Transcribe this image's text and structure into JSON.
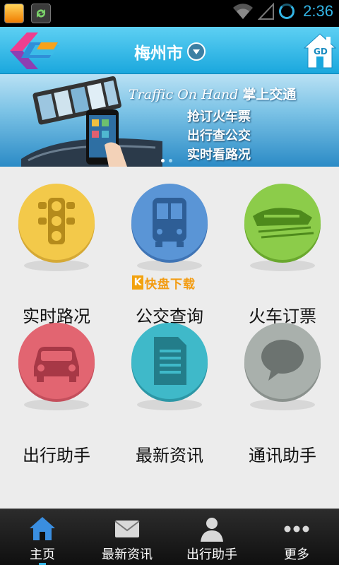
{
  "status_bar": {
    "time": "2:36"
  },
  "header": {
    "city": "梅州市",
    "home_badge": "GD"
  },
  "banner": {
    "tagline_en": "Traffic On Hand",
    "tagline_cn": "掌上交通",
    "lines": [
      "抢订火车票",
      "出行查公交",
      "实时看路况"
    ]
  },
  "grid": [
    {
      "label": "实时路况",
      "icon": "traffic-light-icon",
      "color": "#f3c94a"
    },
    {
      "label": "公交查询",
      "icon": "bus-icon",
      "color": "#5a95d6"
    },
    {
      "label": "火车订票",
      "icon": "train-icon",
      "color": "#8ccc4a"
    },
    {
      "label": "出行助手",
      "icon": "car-icon",
      "color": "#e26571"
    },
    {
      "label": "最新资讯",
      "icon": "document-icon",
      "color": "#3fb9c9"
    },
    {
      "label": "通讯助手",
      "icon": "chat-bubble-icon",
      "color": "#a9b0ac"
    }
  ],
  "watermark": {
    "text": "快盘下载",
    "badge": "K"
  },
  "bottom_nav": [
    {
      "label": "主页",
      "icon": "home-icon",
      "active": true
    },
    {
      "label": "最新资讯",
      "icon": "mail-icon",
      "active": false
    },
    {
      "label": "出行助手",
      "icon": "person-icon",
      "active": false
    },
    {
      "label": "更多",
      "icon": "more-dots-icon",
      "active": false
    }
  ],
  "colors": {
    "accent": "#33b5e5",
    "header_top": "#5ed0f3",
    "header_bottom": "#1aa7dd"
  }
}
